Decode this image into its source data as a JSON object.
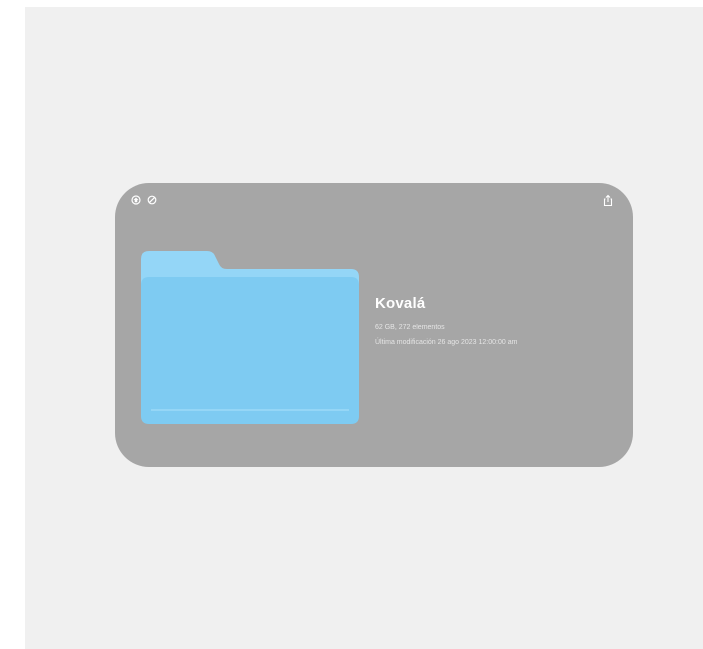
{
  "colors": {
    "page_background": "#f0f0f0",
    "card_background": "#a6a6a6",
    "folder_front": "#7ecbf2",
    "folder_back": "#94d6f7",
    "text_primary": "#ffffff"
  },
  "window_controls": {
    "icons": [
      "eye-icon",
      "hide-icon"
    ],
    "share_icon": "share-icon"
  },
  "item": {
    "icon": "folder-icon",
    "name": "Kovalá",
    "summary": "62 GB, 272 elementos",
    "modified": "Última modificación 26 ago 2023 12:00:00 am"
  }
}
